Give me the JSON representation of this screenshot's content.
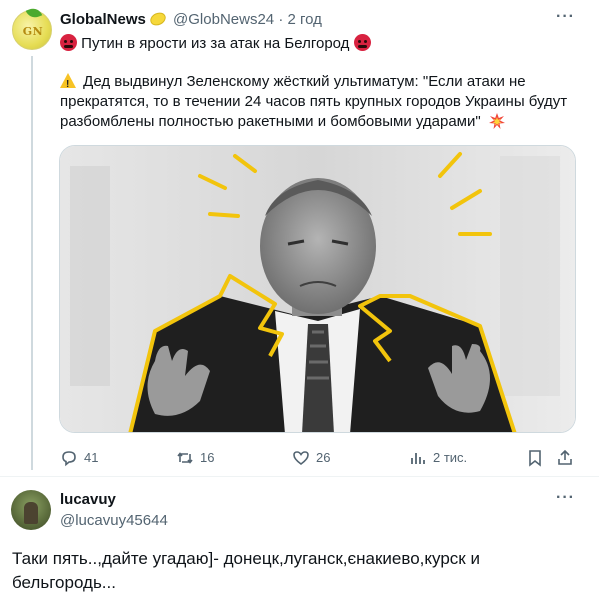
{
  "tweet": {
    "author_name": "GlobalNews",
    "author_handle": "@GlobNews24",
    "time_separator": "·",
    "time": "2 год",
    "more_label": "···",
    "avatar_initials": "GN",
    "headline": "Путин в ярости из за атак на Белгород",
    "body": "Дед выдвинул Зеленскому жёсткий ультиматум: \"Если атаки не прекратятся, то в течении 24 часов пять крупных городов Украины будут разбомблены полностью ракетными и бомбовыми ударами\"",
    "emoji": {
      "angry": "angry-face-icon",
      "warning": "warning-icon",
      "collision": "collision-icon",
      "lemon": "lemon-icon"
    },
    "image_alt": "photo-putin-gesturing",
    "stats": {
      "replies": "41",
      "retweets": "16",
      "likes": "26",
      "views": "2 тис."
    },
    "colors": {
      "accent_yellow": "#f2c40c",
      "text": "#0f1419",
      "secondary": "#536471"
    }
  },
  "reply": {
    "author_name": "lucavuy",
    "author_handle": "@lucavuy45644",
    "more_label": "···",
    "text": "Таки пять..,дайте угадаю]- донецк,луганск,єнакиево,курск и бельгородь..."
  }
}
